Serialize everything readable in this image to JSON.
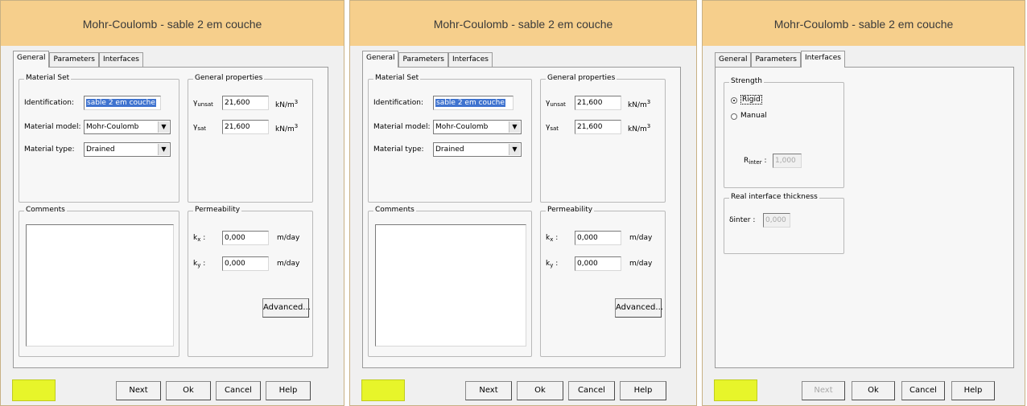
{
  "dialog_title": "Mohr-Coulomb - sable 2 em couche",
  "tabs": [
    "General",
    "Parameters",
    "Interfaces"
  ],
  "general": {
    "material_set": {
      "legend": "Material Set",
      "identification_label": "Identification:",
      "identification_value": "sable 2 em couche",
      "material_model_label": "Material model:",
      "material_model_value": "Mohr-Coulomb",
      "material_type_label": "Material type:",
      "material_type_value": "Drained"
    },
    "general_properties": {
      "legend": "General properties",
      "gamma_symbol": "γ",
      "unsat_sub": "unsat",
      "unsat_value": "21,600",
      "sat_sub": "sat",
      "sat_value": "21,600",
      "unit": "kN/m",
      "unit_sup": "3"
    },
    "comments_legend": "Comments",
    "permeability": {
      "legend": "Permeability",
      "k_symbol": "k",
      "kx_sub": "x",
      "ky_sub": "y",
      "kx_value": "0,000",
      "ky_value": "0,000",
      "unit": "m/day",
      "advanced_label": "Advanced..."
    }
  },
  "interfaces": {
    "strength_legend": "Strength",
    "rigid_label": "Rigid",
    "manual_label": "Manual",
    "rinter_symbol": "R",
    "rinter_sub": "inter",
    "rinter_value": "1,000",
    "real_interface_legend": "Real interface thickness",
    "dinter_label": "δinter :",
    "dinter_value": "0,000"
  },
  "buttons": {
    "next": "Next",
    "ok": "Ok",
    "cancel": "Cancel",
    "help": "Help"
  },
  "colors": {
    "titlebar": "#f6cf8c",
    "material_swatch": "#e7f52a",
    "selection": "#3f73cf"
  }
}
